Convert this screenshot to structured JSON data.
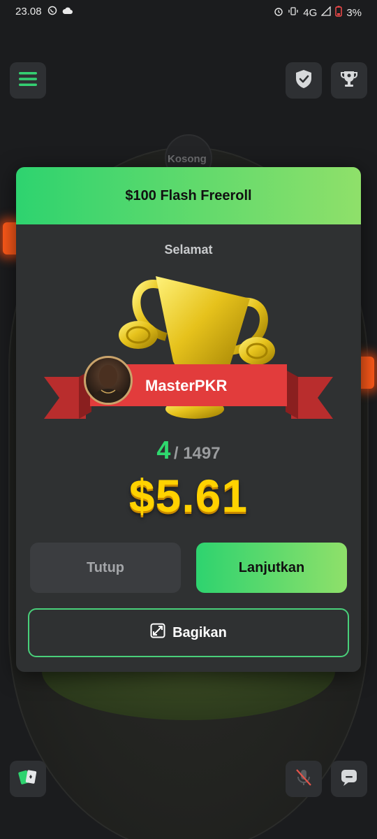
{
  "status_bar": {
    "time": "23.08",
    "network": "4G",
    "battery": "3%"
  },
  "background": {
    "empty_seat": "Kosong"
  },
  "modal": {
    "title": "$100 Flash Freeroll",
    "congrats": "Selamat",
    "player_name": "MasterPKR",
    "rank": "4",
    "rank_total": "/ 1497",
    "prize": "$5.61",
    "close_label": "Tutup",
    "continue_label": "Lanjutkan",
    "share_label": "Bagikan"
  },
  "colors": {
    "accent_green": "#2ed36f",
    "accent_light_green": "#8fe06a",
    "prize_gold": "#ffd200",
    "ribbon_red": "#e23c3c"
  },
  "icons": {
    "menu": "menu-icon",
    "shield": "shield-check-icon",
    "trophy": "trophy-icon",
    "cards": "cards-icon",
    "mic_muted": "mic-muted-icon",
    "chat": "chat-icon",
    "share": "share-expand-icon"
  }
}
